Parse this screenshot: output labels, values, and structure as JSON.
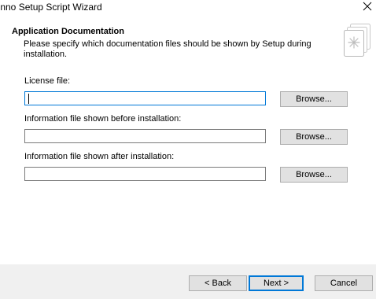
{
  "window": {
    "title": "Inno Setup Script Wizard"
  },
  "header": {
    "title": "Application Documentation",
    "description": "Please specify which documentation files should be shown by Setup during installation."
  },
  "fields": [
    {
      "label": "License file:",
      "value": "",
      "button_label": "Browse..."
    },
    {
      "label": "Information file shown before installation:",
      "value": "",
      "button_label": "Browse..."
    },
    {
      "label": "Information file shown after installation:",
      "value": "",
      "button_label": "Browse..."
    }
  ],
  "footer": {
    "back_label": "< Back",
    "next_label": "Next >",
    "cancel_label": "Cancel"
  },
  "icons": {
    "close": "close-icon",
    "header_image": "documents-icon"
  },
  "colors": {
    "accent": "#0078d7",
    "button_face": "#e1e1e1",
    "footer_background": "#f0f0f0"
  }
}
